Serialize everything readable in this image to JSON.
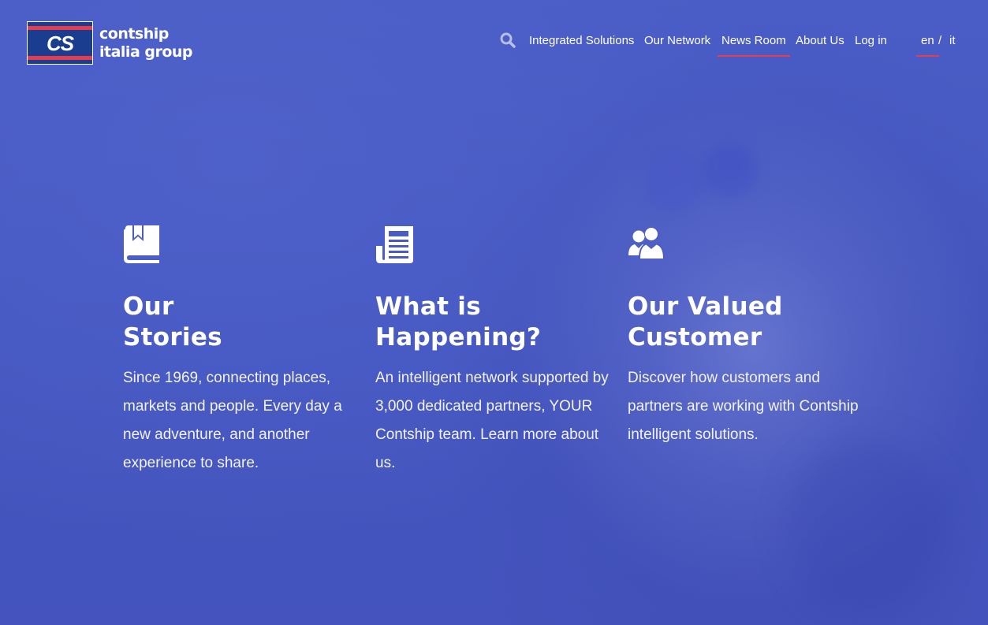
{
  "brand": {
    "logo_mark": "CS",
    "name_line1": "contship",
    "name_line2": "italia group"
  },
  "header": {
    "search_icon": "search-icon",
    "nav": [
      {
        "label": "Integrated Solutions",
        "active": false
      },
      {
        "label": "Our Network",
        "active": false
      },
      {
        "label": "News Room",
        "active": true
      },
      {
        "label": "About Us",
        "active": false
      },
      {
        "label": "Log in",
        "active": false
      }
    ],
    "languages": [
      {
        "label": "en",
        "active": true
      },
      {
        "label": "it",
        "active": false
      }
    ],
    "lang_separator": "/"
  },
  "features": [
    {
      "icon": "book-icon",
      "title_line1": "Our",
      "title_line2": "Stories",
      "text": "Since 1969, connecting places, markets and people. Every day a new adventure, and another experience to share."
    },
    {
      "icon": "newspaper-icon",
      "title_line1": "What is",
      "title_line2": "Happening?",
      "text": "An intelligent network supported by 3,000 dedicated partners, YOUR Contship team. Learn more about us."
    },
    {
      "icon": "users-icon",
      "title_line1": "Our Valued",
      "title_line2": "Customer",
      "text": "Discover how customers and partners are working with Contship intelligent solutions."
    }
  ],
  "colors": {
    "background": "#4658c2",
    "accent": "#e53c4f",
    "logo_blue": "#1b3d8f"
  }
}
